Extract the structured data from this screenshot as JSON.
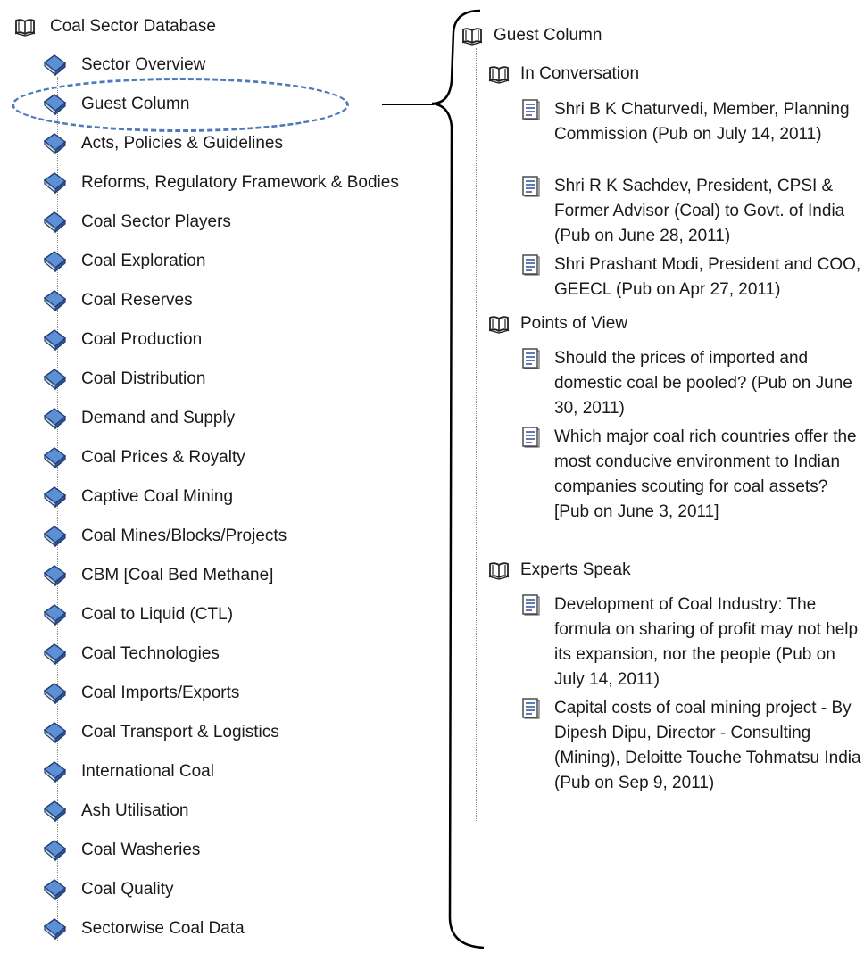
{
  "left_tree": {
    "root_label": "Coal Sector Database",
    "items": [
      "Sector Overview",
      "Guest Column",
      "Acts, Policies & Guidelines",
      "Reforms, Regulatory Framework & Bodies",
      "Coal Sector Players",
      "Coal Exploration",
      "Coal Reserves",
      "Coal Production",
      "Coal Distribution",
      "Demand and Supply",
      "Coal Prices & Royalty",
      "Captive Coal Mining",
      "Coal Mines/Blocks/Projects",
      "CBM [Coal Bed Methane]",
      "Coal to Liquid (CTL)",
      "Coal Technologies",
      "Coal Imports/Exports",
      "Coal Transport & Logistics",
      "International Coal",
      "Ash Utilisation",
      "Coal Washeries",
      "Coal Quality",
      "Sectorwise Coal Data"
    ]
  },
  "right_tree": {
    "title": "Guest Column",
    "sections": [
      {
        "label": "In Conversation",
        "items": [
          "Shri B K Chaturvedi, Member, Planning Commission (Pub on July 14, 2011)",
          "Shri R K Sachdev, President, CPSI & Former Advisor (Coal) to Govt. of India (Pub on June 28, 2011)",
          "Shri Prashant Modi, President and COO, GEECL (Pub on Apr 27, 2011)"
        ]
      },
      {
        "label": "Points of View",
        "items": [
          "Should the prices of imported and domestic coal be pooled? (Pub on June 30, 2011)",
          "Which major coal rich countries offer the most conducive environment to Indian companies scouting for coal assets? [Pub on June 3, 2011]"
        ]
      },
      {
        "label": "Experts Speak",
        "items": [
          "Development of Coal Industry: The formula on sharing of profit may not help its expansion, nor the people (Pub on July 14, 2011)",
          "Capital costs of coal mining project - By Dipesh Dipu, Director - Consulting (Mining), Deloitte Touche Tohmatsu India (Pub on Sep 9, 2011)"
        ]
      }
    ]
  },
  "colors": {
    "book_blue": "#4f7fc4",
    "highlight_dash": "#4d7ab8",
    "text": "#1a1a1a"
  }
}
